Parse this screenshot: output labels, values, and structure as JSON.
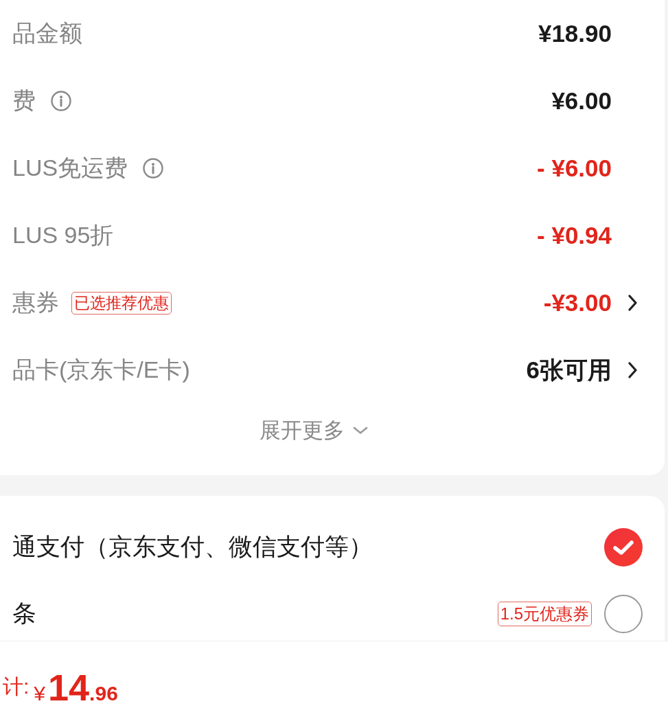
{
  "price_details": {
    "rows": [
      {
        "label": "品金额",
        "info_icon": false,
        "value": "¥18.90",
        "discount": false,
        "chevron": false
      },
      {
        "label": "费",
        "info_icon": true,
        "value": "¥6.00",
        "discount": false,
        "chevron": false
      },
      {
        "label": "LUS免运费",
        "info_icon": true,
        "value": "- ¥6.00",
        "discount": true,
        "chevron": false
      },
      {
        "label": "LUS 95折",
        "info_icon": false,
        "value": "- ¥0.94",
        "discount": true,
        "chevron": false
      },
      {
        "label": "惠券",
        "info_icon": false,
        "tag": "已选推荐优惠",
        "value": "-¥3.00",
        "discount": true,
        "chevron": true
      },
      {
        "label": "品卡(京东卡/E卡)",
        "info_icon": false,
        "value": "6张可用",
        "discount": false,
        "chevron": true
      }
    ],
    "expand": {
      "label": "展开更多"
    }
  },
  "payment_methods": [
    {
      "label": "通支付（京东支付、微信支付等）",
      "selected": true
    },
    {
      "label": "条",
      "tag": "1.5元优惠券",
      "selected": false
    }
  ],
  "footer": {
    "total_label": "计:",
    "currency": "¥",
    "integer": "14",
    "decimal": ".96"
  }
}
